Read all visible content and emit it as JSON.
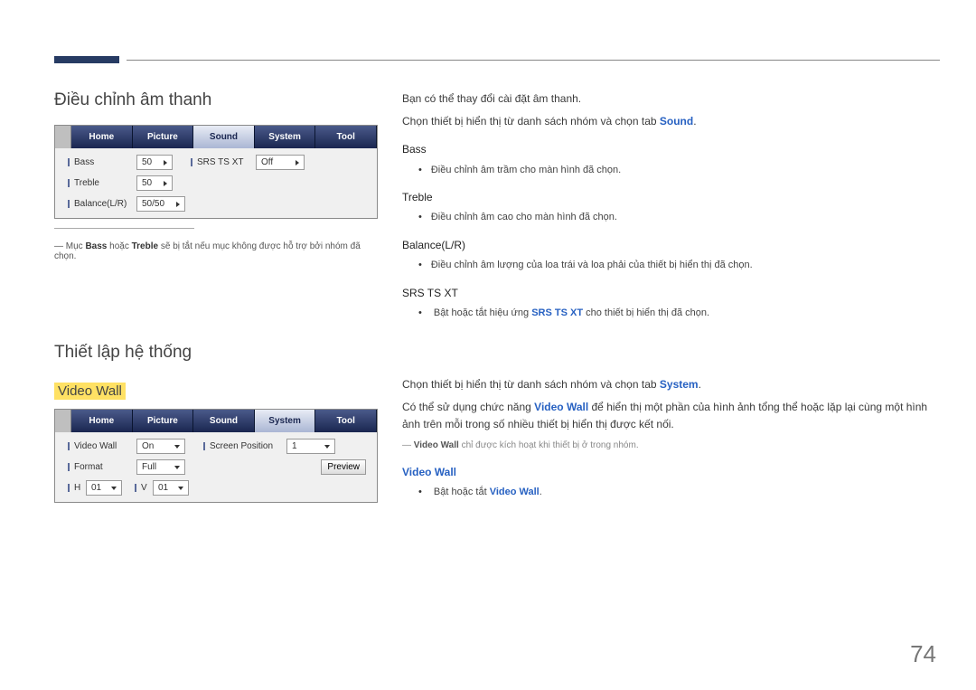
{
  "page_number": "74",
  "section1": {
    "title": "Điều chỉnh âm thanh",
    "ui": {
      "tabs": [
        "Home",
        "Picture",
        "Sound",
        "System",
        "Tool"
      ],
      "active_tab_index": 2,
      "rows": {
        "bass_label": "Bass",
        "bass_val": "50",
        "treble_label": "Treble",
        "treble_val": "50",
        "balance_label": "Balance(L/R)",
        "balance_val": "50/50",
        "srs_label": "SRS TS XT",
        "srs_val": "Off"
      }
    },
    "footnote_pre": "Mục ",
    "footnote_bass": "Bass",
    "footnote_mid": " hoặc ",
    "footnote_treble": "Treble",
    "footnote_post": " sẽ bị tắt nếu mục không được hỗ trợ bởi nhóm đã chọn."
  },
  "section1_right": {
    "line1": "Bạn có thể thay đổi cài đặt âm thanh.",
    "line2_pre": "Chọn thiết bị hiển thị từ danh sách nhóm và chọn tab ",
    "line2_bold": "Sound",
    "line2_post": ".",
    "bass_h": "Bass",
    "bass_li": "Điều chỉnh âm trầm cho màn hình đã chọn.",
    "treble_h": "Treble",
    "treble_li": "Điều chỉnh âm cao cho màn hình đã chọn.",
    "balance_h": "Balance(L/R)",
    "balance_li": "Điều chỉnh âm lượng của loa trái và loa phải của thiết bị hiển thị đã chọn.",
    "srs_h": "SRS TS XT",
    "srs_li_pre": "Bật hoặc tắt hiệu ứng ",
    "srs_li_bold": "SRS TS XT",
    "srs_li_post": " cho thiết bị hiển thị đã chọn."
  },
  "section2": {
    "title": "Thiết lập hệ thống",
    "subtitle": "Video Wall",
    "ui": {
      "tabs": [
        "Home",
        "Picture",
        "Sound",
        "System",
        "Tool"
      ],
      "active_tab_index": 3,
      "rows": {
        "vw_label": "Video Wall",
        "vw_val": "On",
        "sp_label": "Screen Position",
        "sp_val": "1",
        "format_label": "Format",
        "format_val": "Full",
        "preview_btn": "Preview",
        "h_label": "H",
        "h_val": "01",
        "v_label": "V",
        "v_val": "01"
      }
    }
  },
  "section2_right": {
    "line1_pre": "Chọn thiết bị hiển thị từ danh sách nhóm và chọn tab ",
    "line1_bold": "System",
    "line1_post": ".",
    "line2_pre": "Có thể sử dụng chức năng ",
    "line2_bold": "Video Wall",
    "line2_post": " để hiển thị một phần của hình ảnh tổng thể hoặc lặp lại cùng một hình ảnh trên mỗi trong số nhiều thiết bị hiển thị được kết nối.",
    "note_bold": "Video Wall",
    "note_rest": " chỉ được kích hoạt khi thiết bị ở trong nhóm.",
    "vw_h": "Video Wall",
    "vw_li_pre": "Bật hoặc tắt ",
    "vw_li_bold": "Video Wall",
    "vw_li_post": "."
  }
}
